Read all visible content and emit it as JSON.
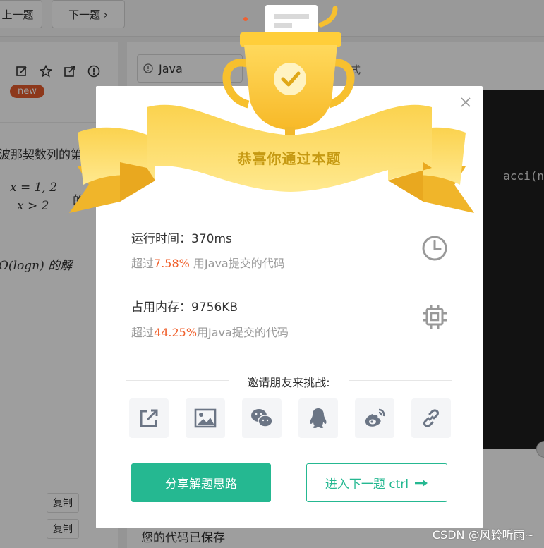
{
  "nav": {
    "prev_label": "上一题",
    "next_label": "下一题 ›"
  },
  "problem": {
    "badge": "new",
    "desc_line": "波那契数列的第",
    "formula_a": "x = 1, 2",
    "formula_b": "x > 2",
    "formula_suffix": "的",
    "complexity": "O(logn) 的解"
  },
  "copy_buttons": [
    "复制",
    "复制"
  ],
  "editor": {
    "language": "Java",
    "mode_label": "式",
    "code_fragment": "acci(n",
    "saved_status": "您的代码已保存"
  },
  "modal": {
    "title": "恭喜你通过本题",
    "runtime": {
      "label": "运行时间：",
      "value": "370ms",
      "beat_prefix": "超过",
      "beat_percent": "7.58%",
      "beat_suffix": " 用Java提交的代码"
    },
    "memory": {
      "label": "占用内存：",
      "value": "9756KB",
      "beat_prefix": "超过",
      "beat_percent": "44.25%",
      "beat_suffix": "用Java提交的代码"
    },
    "invite_text": "邀请朋友来挑战:",
    "share_icons": [
      "share-external-icon",
      "image-icon",
      "wechat-icon",
      "qq-icon",
      "weibo-icon",
      "link-icon"
    ],
    "primary_button": "分享解题思路",
    "secondary_button": "进入下一题 ctrl"
  },
  "colors": {
    "accent_green": "#25b891",
    "highlight_orange": "#f0602c",
    "trophy_gold": "#fcc537",
    "badge_red": "#e45b2c"
  },
  "watermark": "CSDN @风铃听雨~"
}
